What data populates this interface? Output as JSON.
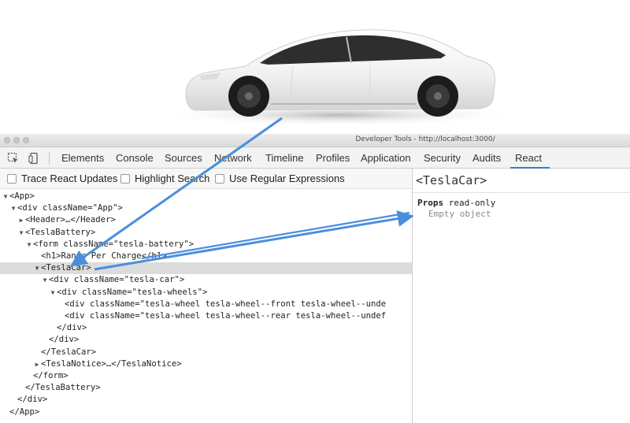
{
  "window": {
    "title": "Developer Tools - http://localhost:3000/"
  },
  "toolbar": {
    "tabs": [
      {
        "label": "Elements"
      },
      {
        "label": "Console"
      },
      {
        "label": "Sources"
      },
      {
        "label": "Network"
      },
      {
        "label": "Timeline"
      },
      {
        "label": "Profiles"
      },
      {
        "label": "Application"
      },
      {
        "label": "Security"
      },
      {
        "label": "Audits"
      },
      {
        "label": "React"
      }
    ],
    "active_tab": "React"
  },
  "options": {
    "trace": "Trace React Updates",
    "highlight": "Highlight Search",
    "regex": "Use Regular Expressions"
  },
  "tree": {
    "rows": [
      {
        "text": "<App>",
        "toggle": "▼"
      },
      {
        "text": "<div className=\"App\">",
        "toggle": "▼"
      },
      {
        "text": "<Header>…</Header>",
        "toggle": "▶"
      },
      {
        "text": "<TeslaBattery>",
        "toggle": "▼"
      },
      {
        "text": "<form className=\"tesla-battery\">",
        "toggle": "▼"
      },
      {
        "text": "<h1>Range Per Charge</h1>",
        "toggle": ""
      },
      {
        "text": "<TeslaCar>",
        "toggle": "▼"
      },
      {
        "text": "<div className=\"tesla-car\">",
        "toggle": "▼"
      },
      {
        "text": "<div className=\"tesla-wheels\">",
        "toggle": "▼"
      },
      {
        "text": "<div className=\"tesla-wheel tesla-wheel--front tesla-wheel--unde",
        "toggle": ""
      },
      {
        "text": "<div className=\"tesla-wheel tesla-wheel--rear tesla-wheel--undef",
        "toggle": ""
      },
      {
        "text": "</div>",
        "toggle": ""
      },
      {
        "text": "</div>",
        "toggle": ""
      },
      {
        "text": "</TeslaCar>",
        "toggle": ""
      },
      {
        "text": "<TeslaNotice>…</TeslaNotice>",
        "toggle": "▶"
      },
      {
        "text": "</form>",
        "toggle": ""
      },
      {
        "text": "</TeslaBattery>",
        "toggle": ""
      },
      {
        "text": "</div>",
        "toggle": ""
      },
      {
        "text": "</App>",
        "toggle": ""
      }
    ]
  },
  "side_panel": {
    "component": "<TeslaCar>",
    "props_label": "Props",
    "props_note": "read-only",
    "props_empty": "Empty object"
  },
  "colors": {
    "accent": "#3879d9",
    "arrow": "#4a8fdc",
    "selected_row": "#dcdcdc",
    "car_body": "#f4f4f4"
  }
}
